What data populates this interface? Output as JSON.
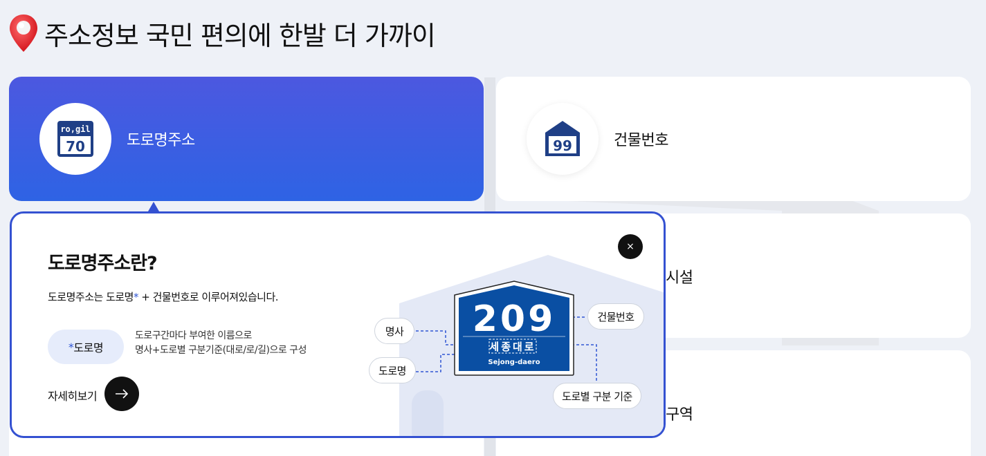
{
  "page": {
    "title": "주소정보 국민 편의에 한발 더 가까이",
    "pin_icon": "location-pin-icon"
  },
  "cards": [
    {
      "label": "도로명주소",
      "icon": "road-sign-icon",
      "sign_top": "ro,gil",
      "sign_number": "70",
      "active": true
    },
    {
      "label": "건물번호",
      "icon": "building-number-icon",
      "sign_number": "99",
      "active": false
    },
    {
      "label_visible": "시설",
      "partial": true
    },
    {
      "label_visible": "구역",
      "partial": true
    }
  ],
  "popup": {
    "title": "도로명주소란?",
    "desc_main": "도로명주소는 도로명",
    "desc_star": "*",
    "desc_rest": " + 건물번호로 이루어져있습니다.",
    "tag_star": "*",
    "tag_label": "도로명",
    "tag_desc_line1": "도로구간마다 부여한 이름으로",
    "tag_desc_line2": "명사+도로별 구분기준(대로/로/길)으로 구성",
    "more_label": "자세히보기",
    "close_symbol": "×",
    "sign": {
      "number": "209",
      "name": "세종대로",
      "romanized": "Sejong-daero"
    },
    "callouts": {
      "noun": "명사",
      "road_name": "도로명",
      "building_number": "건물번호",
      "road_type": "도로별 구분 기준"
    }
  },
  "colors": {
    "active_card_top": "#4c58e0",
    "active_card_bottom": "#2e63e4",
    "accent_blue": "#2f55d4",
    "sign_blue": "#0a4fa3",
    "popup_border": "#3451d1",
    "background": "#eef1f7"
  }
}
